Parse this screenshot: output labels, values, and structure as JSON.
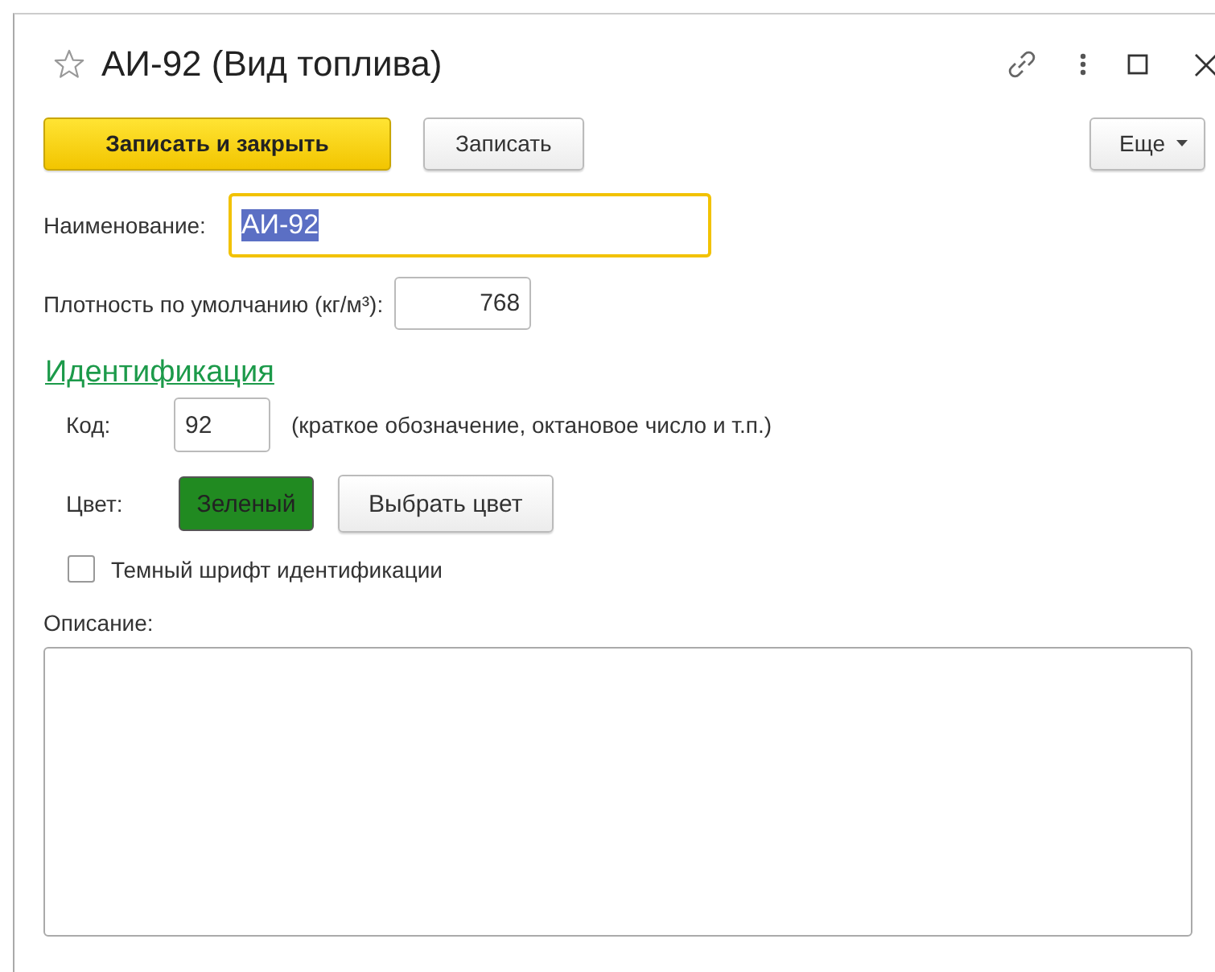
{
  "window": {
    "title": "АИ-92 (Вид топлива)",
    "favorite": false
  },
  "toolbar": {
    "buttons": [
      {
        "label": "Записать и закрыть",
        "kind": "primary"
      },
      {
        "label": "Записать",
        "kind": "normal"
      }
    ],
    "more": "Еще"
  },
  "name_field": {
    "label": "Наименование:",
    "value": "АИ-92",
    "focused": true
  },
  "density_field": {
    "label": "Плотность по умолчанию (кг/м³):",
    "value": "768"
  },
  "identification": {
    "title": "Идентификация",
    "code": {
      "label": "Код:",
      "value": "92",
      "hint": "(краткое обозначение, октановое число и т.п.)"
    },
    "color": {
      "label": "Цвет:",
      "value": "Зеленый",
      "color": "#218a21",
      "button": "Выбрать цвет"
    },
    "dark_font": {
      "label": "Темный шрифт идентификации",
      "checked": false
    }
  },
  "description": {
    "label": "Описание:"
  }
}
